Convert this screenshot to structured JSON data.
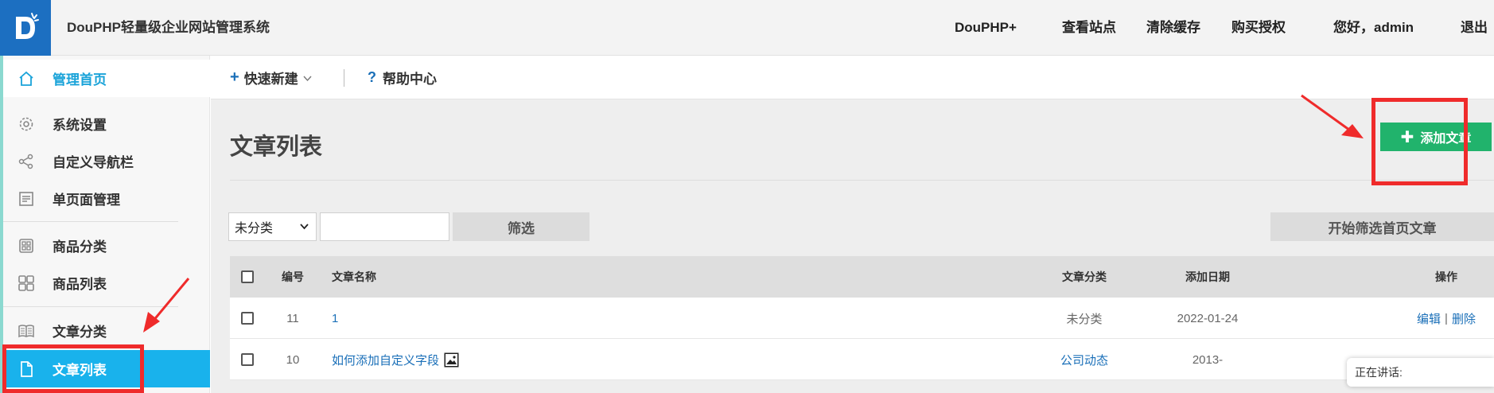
{
  "header": {
    "app_title": "DouPHP轻量级企业网站管理系统",
    "nav": [
      "DouPHP+",
      "查看站点",
      "清除缓存",
      "购买授权",
      "您好，admin",
      "退出"
    ]
  },
  "sidebar": {
    "home": "管理首页",
    "items": [
      {
        "label": "系统设置",
        "icon": "gear-icon"
      },
      {
        "label": "自定义导航栏",
        "icon": "share-icon"
      },
      {
        "label": "单页面管理",
        "icon": "page-icon"
      },
      {
        "label": "商品分类",
        "icon": "grid-icon"
      },
      {
        "label": "商品列表",
        "icon": "grid4-icon"
      },
      {
        "label": "文章分类",
        "icon": "book-icon"
      },
      {
        "label": "文章列表",
        "icon": "file-icon"
      }
    ]
  },
  "subbar": {
    "quick_new": "快速新建",
    "help_center": "帮助中心"
  },
  "main": {
    "title": "文章列表",
    "add_button": "添加文章",
    "filter_select_value": "未分类",
    "filter_input_value": "",
    "filter_button": "筛选",
    "home_filter_button": "开始筛选首页文章"
  },
  "table": {
    "headers": [
      "编号",
      "文章名称",
      "文章分类",
      "添加日期",
      "操作"
    ],
    "rows": [
      {
        "id": "11",
        "name": "1",
        "category": "未分类",
        "date": "2022-01-24",
        "has_image": false
      },
      {
        "id": "10",
        "name": "如何添加自定义字段",
        "category": "公司动态",
        "date": "2013-",
        "has_image": true
      }
    ],
    "edit_label": "编辑",
    "delete_label": "删除",
    "action_sep": "|"
  },
  "chat_widget": {
    "text": "正在讲话:"
  },
  "colors": {
    "brand_blue": "#1c6fc1",
    "sidebar_active": "#19b2ec",
    "add_green": "#21b36c",
    "annotation_red": "#ef2b2b",
    "link_blue": "#1a6fb8"
  }
}
